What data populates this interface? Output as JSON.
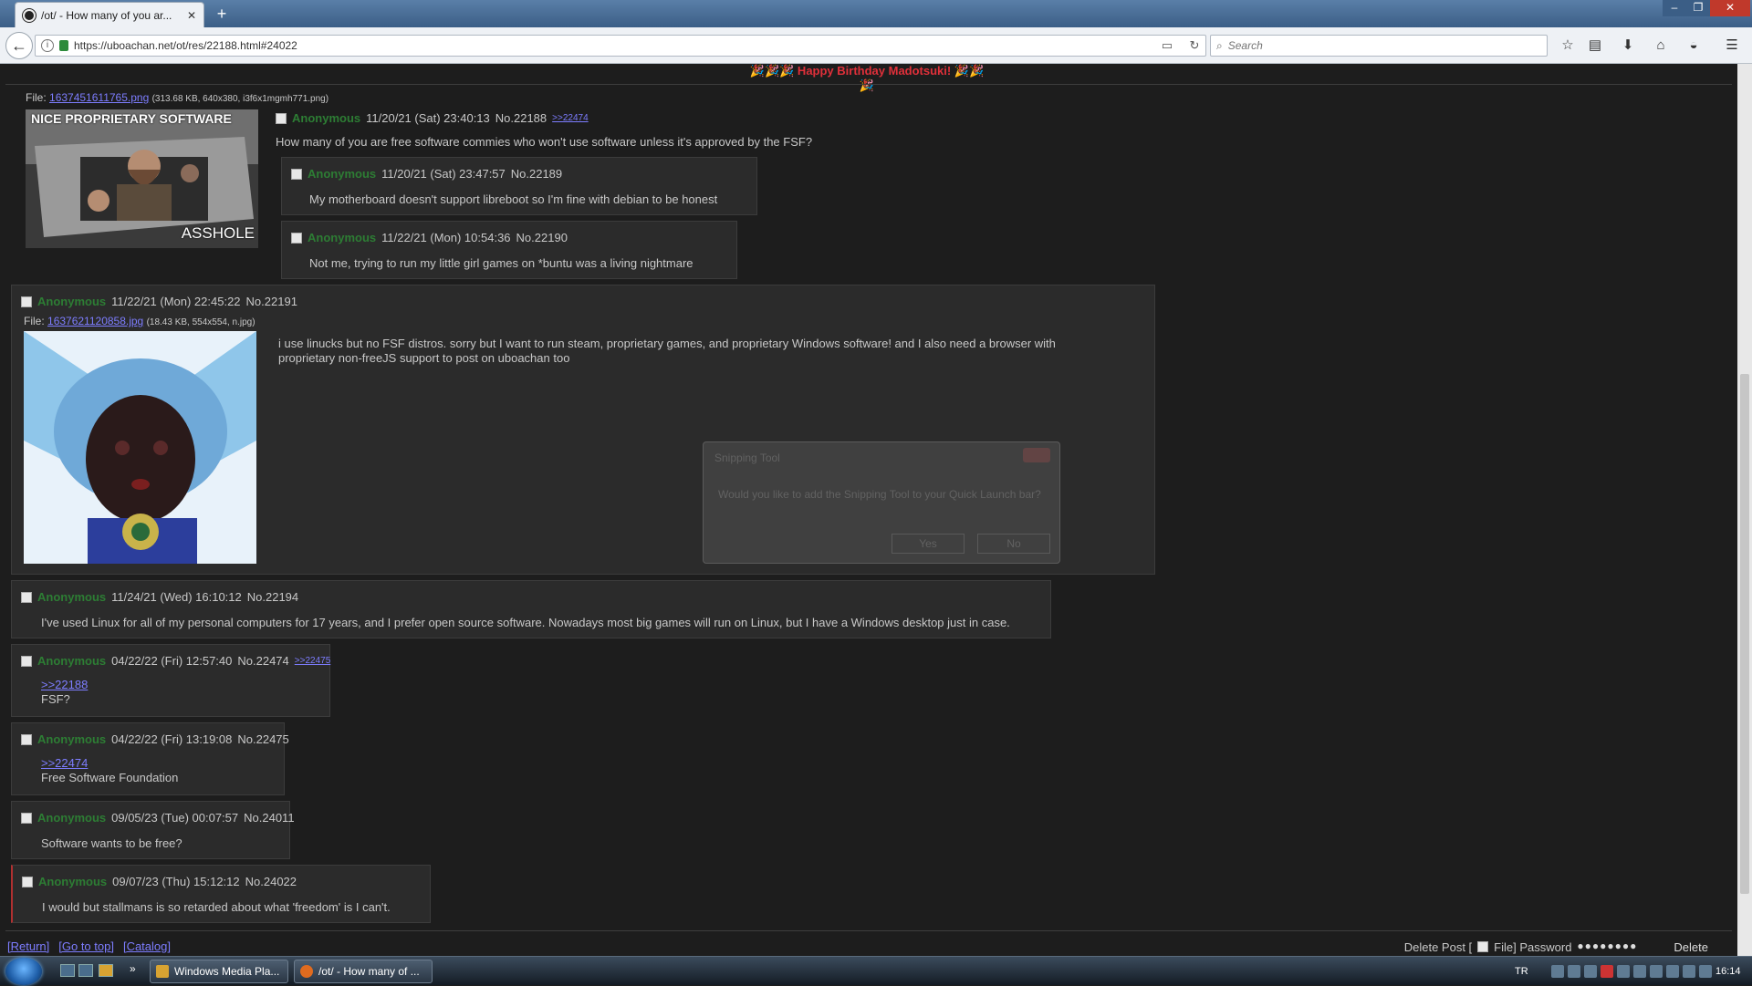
{
  "browser": {
    "tab_title": "/ot/ - How many of you ar...",
    "tab_close": "✕",
    "new_tab": "+",
    "url": "https://uboachan.net/ot/res/22188.html#24022",
    "search_placeholder": "Search",
    "window_controls": {
      "minimize": "–",
      "maximize": "❐",
      "close": "✕"
    },
    "toolbar_icons": [
      "star-icon",
      "library-icon",
      "download-icon",
      "home-icon",
      "pocket-icon",
      "menu-icon"
    ]
  },
  "page": {
    "banner": "🎉🎉🎉 Happy Birthday Madotsuki! 🎉🎉🎉",
    "op": {
      "file_label": "File: ",
      "file_name": "1637451611765.png",
      "file_meta": "(313.68 KB, 640x380, i3f6x1mgmh771.png)",
      "image_caption_top": "NICE PROPRIETARY SOFTWARE",
      "image_caption_bottom": "ASSHOLE",
      "name": "Anonymous",
      "date": "11/20/21 (Sat) 23:40:13",
      "number": "No.22188",
      "backlink": ">>22474",
      "body": "How many of you are free software commies who won't use software unless it's approved by the FSF?"
    },
    "replies": [
      {
        "name": "Anonymous",
        "date": "11/20/21 (Sat) 23:47:57",
        "number": "No.22189",
        "body": "My motherboard doesn't support libreboot so I'm fine with debian to be honest"
      },
      {
        "name": "Anonymous",
        "date": "11/22/21 (Mon) 10:54:36",
        "number": "No.22190",
        "body": "Not me, trying to run my little girl games on *buntu was a living nightmare"
      },
      {
        "name": "Anonymous",
        "date": "11/22/21 (Mon) 22:45:22",
        "number": "No.22191",
        "file_label": "File: ",
        "file_name": "1637621120858.jpg",
        "file_meta": "(18.43 KB, 554x554, n.jpg)",
        "body_line1": "i use linucks but no FSF distros. sorry but I want to run steam, proprietary games, and proprietary Windows software! and I also need a browser with",
        "body_line2": "proprietary non-freeJS support to post on uboachan too"
      },
      {
        "name": "Anonymous",
        "date": "11/24/21 (Wed) 16:10:12",
        "number": "No.22194",
        "body": "I've used Linux for all of my personal computers for 17 years, and I prefer open source software. Nowadays most big games will run on Linux, but I have a Windows desktop just in case."
      },
      {
        "name": "Anonymous",
        "date": "04/22/22 (Fri) 12:57:40",
        "number": "No.22474",
        "backlink": ">>22475",
        "quote": ">>22188",
        "body": "FSF?"
      },
      {
        "name": "Anonymous",
        "date": "04/22/22 (Fri) 13:19:08",
        "number": "No.22475",
        "quote": ">>22474",
        "body": "Free Software Foundation"
      },
      {
        "name": "Anonymous",
        "date": "09/05/23 (Tue) 00:07:57",
        "number": "No.24011",
        "body": "Software wants to be free?"
      },
      {
        "name": "Anonymous",
        "date": "09/07/23 (Thu) 15:12:12",
        "number": "No.24022",
        "body": "I would but stallmans is so retarded about what 'freedom' is I can't."
      }
    ],
    "ghost_dialog": {
      "title": "Snipping Tool",
      "message": "Would you like to add the Snipping Tool to your Quick Launch bar?",
      "yes": "Yes",
      "no": "No"
    },
    "footer": {
      "return": "[Return]",
      "top": "[Go to top]",
      "catalog": "[Catalog]",
      "delete_post": "Delete Post [",
      "file_label": "File] Password",
      "password_mask": "●●●●●●●●",
      "delete": "Delete"
    }
  },
  "taskbar": {
    "items": [
      {
        "label": "Windows Media Pla..."
      },
      {
        "label": "/ot/ - How many of ..."
      }
    ],
    "language": "TR",
    "clock": "16:14",
    "chevron": "»"
  },
  "colors": {
    "name_green": "#2d7d34",
    "link_blue": "#7d7dff",
    "banner_red": "#e0303a",
    "page_bg": "#1d1d1d",
    "post_bg": "#2b2b2b"
  }
}
